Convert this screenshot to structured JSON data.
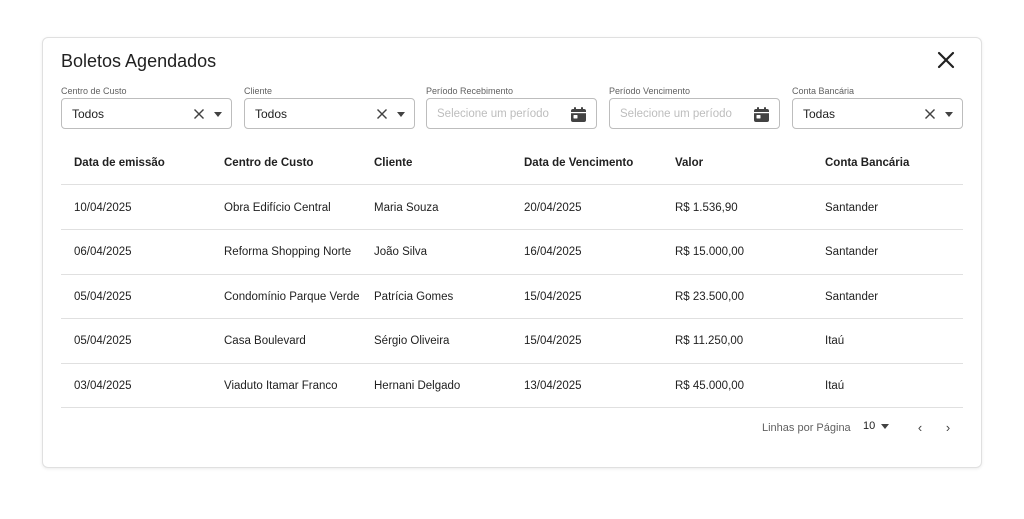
{
  "modal": {
    "title": "Boletos Agendados"
  },
  "filters": {
    "cost_center": {
      "label": "Centro de Custo",
      "value": "Todos"
    },
    "client": {
      "label": "Cliente",
      "value": "Todos"
    },
    "receipt_period": {
      "label": "Período Recebimento",
      "placeholder": "Selecione um período"
    },
    "due_period": {
      "label": "Período Vencimento",
      "placeholder": "Selecione um período"
    },
    "bank_account": {
      "label": "Conta Bancária",
      "value": "Todas"
    }
  },
  "table": {
    "columns": [
      "Data de emissão",
      "Centro de Custo",
      "Cliente",
      "Data de Vencimento",
      "Valor",
      "Conta Bancária"
    ],
    "rows": [
      [
        "10/04/2025",
        "Obra Edifício Central",
        "Maria Souza",
        "20/04/2025",
        "R$ 1.536,90",
        "Santander"
      ],
      [
        "06/04/2025",
        "Reforma Shopping Norte",
        "João Silva",
        "16/04/2025",
        "R$ 15.000,00",
        "Santander"
      ],
      [
        "05/04/2025",
        "Condomínio Parque Verde",
        "Patrícia Gomes",
        "15/04/2025",
        "R$ 23.500,00",
        "Santander"
      ],
      [
        "05/04/2025",
        "Casa Boulevard",
        "Sérgio Oliveira",
        "15/04/2025",
        "R$ 11.250,00",
        "Itaú"
      ],
      [
        "03/04/2025",
        "Viaduto Itamar Franco",
        "Hernani Delgado",
        "13/04/2025",
        "R$ 45.000,00",
        "Itaú"
      ]
    ]
  },
  "pagination": {
    "rows_per_page_label": "Linhas por Página",
    "rows_per_page": "10",
    "prev_icon": "‹",
    "next_icon": "›"
  },
  "icons": {
    "close": "close-icon",
    "clear": "clear-x-icon",
    "calendar": "calendar-icon",
    "dropdown": "caret-down-icon"
  },
  "colors": {
    "text": "#212121",
    "muted": "#616161",
    "border": "#bdbdbd",
    "placeholder": "#bdbdbd",
    "divider": "#e0e0e0"
  }
}
